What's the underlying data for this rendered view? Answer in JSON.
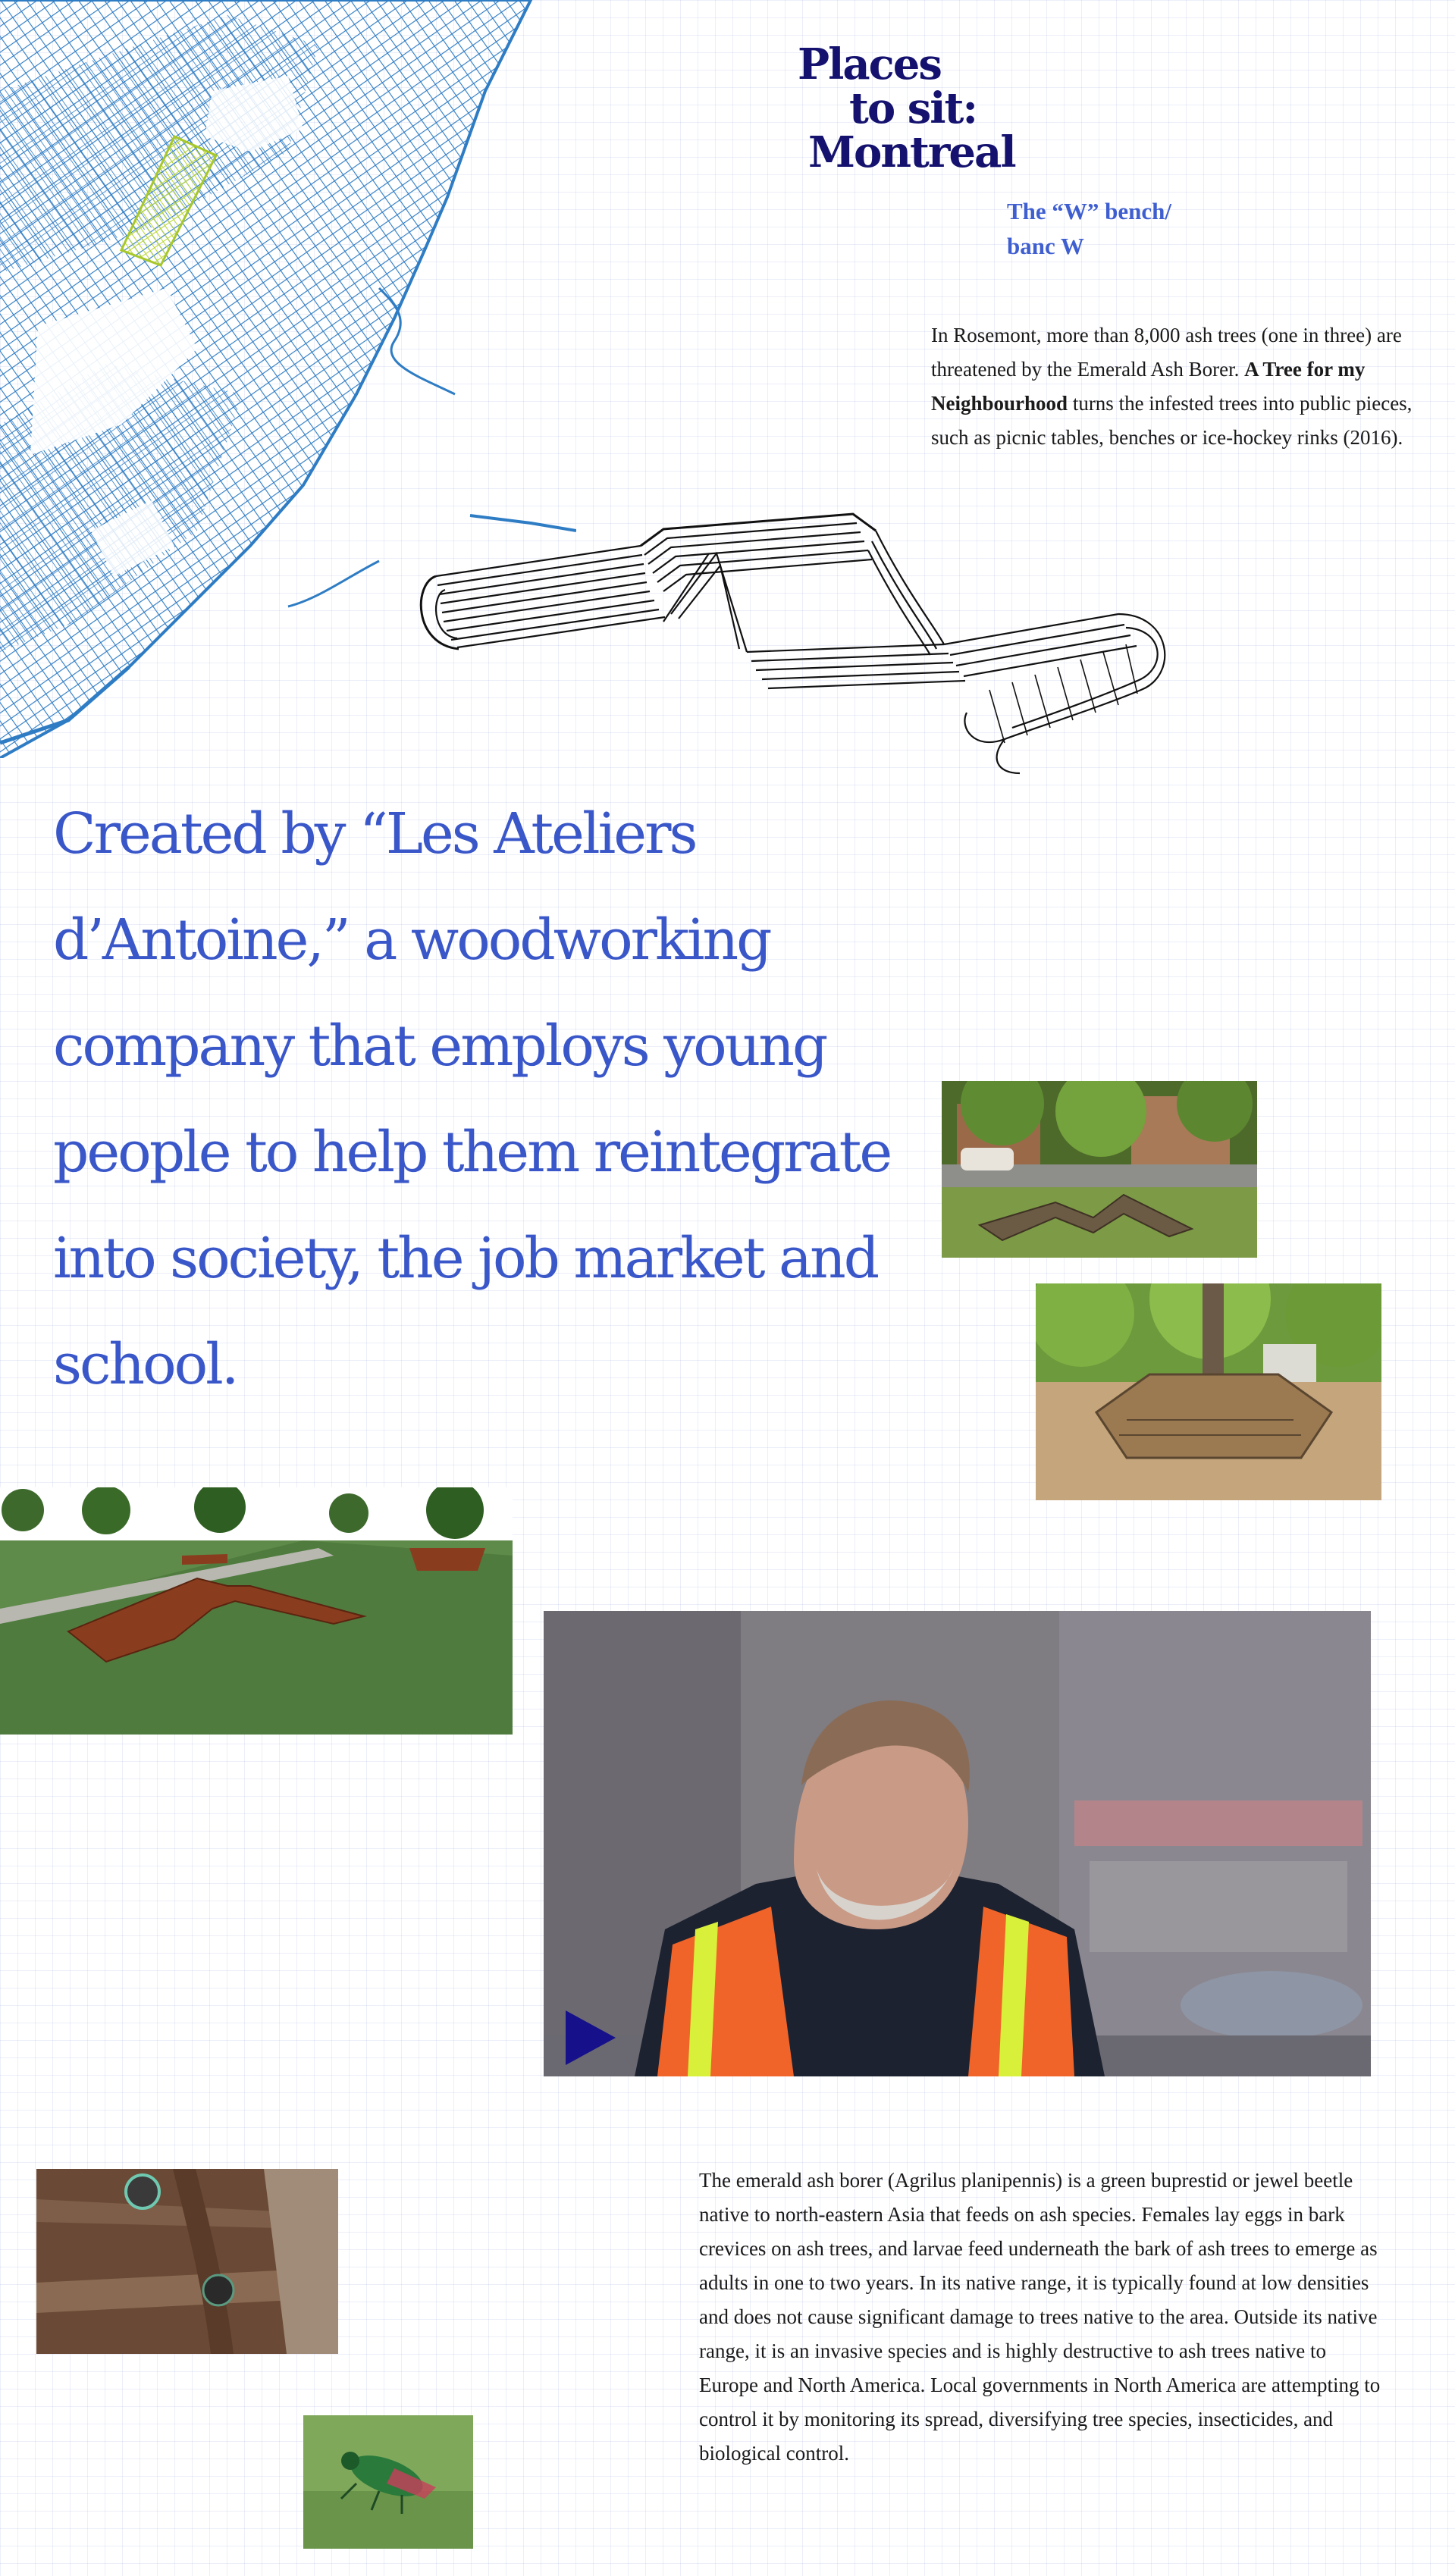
{
  "header": {
    "title_line1": "Places",
    "title_line2": "to sit:",
    "title_line3": "Montreal",
    "subtitle_line1": "The “W” bench/",
    "subtitle_line2": "banc W"
  },
  "intro": {
    "part1": "In Rosemont, more than 8,000 ash trees (one in three) are threatened by the Emerald Ash Borer. ",
    "bold": "A Tree for my Neighbourhood",
    "part2": " turns the infested trees into public pieces, such as picnic tables, benches or ice-hockey rinks (2016)."
  },
  "quote": {
    "text": "Created by “Les Ateliers d’Antoine,” a woodworking company that employs young people to help them reintegrate into society, the job market and school."
  },
  "video": {
    "play_icon": "play-icon"
  },
  "ash_borer": {
    "text": "The emerald ash borer (Agrilus planipennis) is a green buprestid or jewel beetle native to north-eastern Asia that feeds on ash species. Females lay eggs in bark crevices on ash trees, and larvae feed underneath the bark of ash trees to emerge as adults in one to two years. In its native range, it is typically found at low densities and does not cause significant damage to trees native to the area. Outside its native range, it is an invasive species and is highly destructive to ash trees native to Europe and North America. Local governments in North America are attempting to control it by monitoring its spread, diversifying tree species, insecticides, and biological control."
  },
  "colors": {
    "title": "#14126e",
    "accent": "#3a57c9",
    "map_streets": "#2e7cc4",
    "map_highlight": "#c8e63c"
  }
}
